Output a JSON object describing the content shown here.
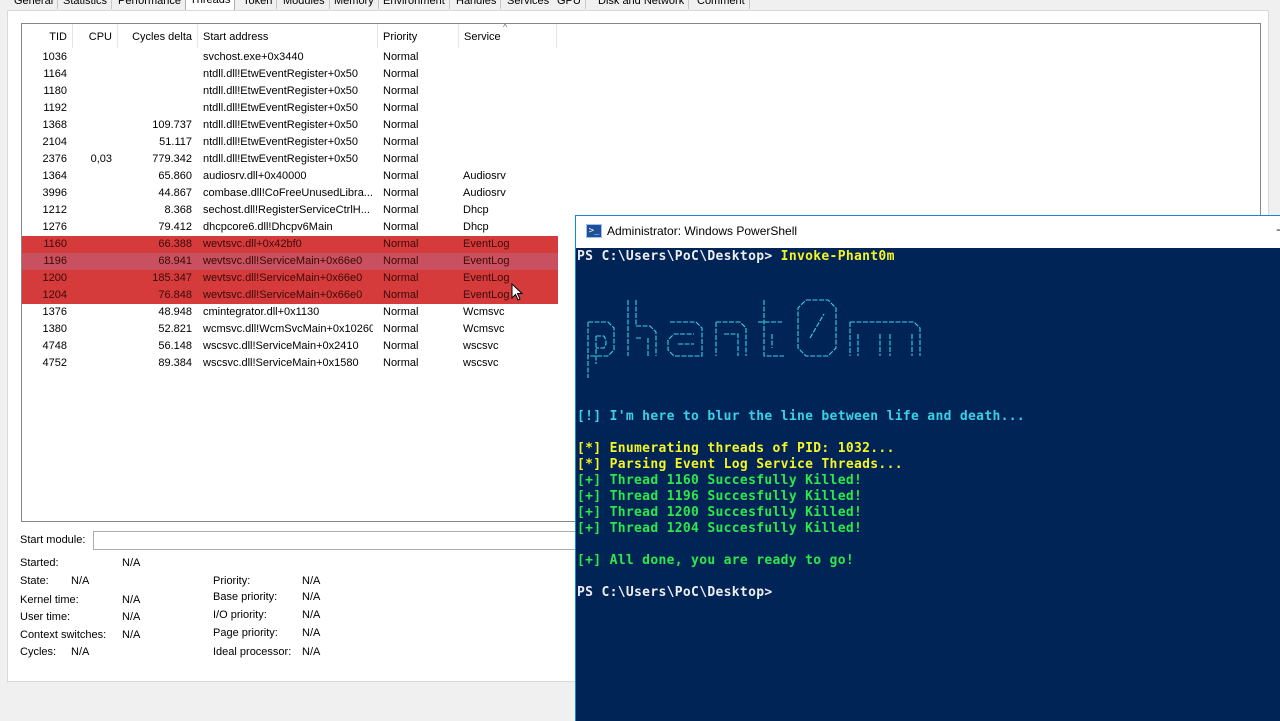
{
  "tabs": [
    "General",
    "Statistics",
    "Performance",
    "Threads",
    "Token",
    "Modules",
    "Memory",
    "Environment",
    "Handles",
    "Services",
    "GPU",
    "Disk and Network",
    "Comment"
  ],
  "active_tab": "Threads",
  "columns": {
    "tid": "TID",
    "cpu": "CPU",
    "cycles": "Cycles delta",
    "address": "Start address",
    "priority": "Priority",
    "service": "Service"
  },
  "threads": [
    {
      "tid": "1036",
      "cpu": "",
      "cycles": "",
      "address": "svchost.exe+0x3440",
      "priority": "Normal",
      "service": "",
      "highlight": false
    },
    {
      "tid": "1164",
      "cpu": "",
      "cycles": "",
      "address": "ntdll.dll!EtwEventRegister+0x50",
      "priority": "Normal",
      "service": "",
      "highlight": false
    },
    {
      "tid": "1180",
      "cpu": "",
      "cycles": "",
      "address": "ntdll.dll!EtwEventRegister+0x50",
      "priority": "Normal",
      "service": "",
      "highlight": false
    },
    {
      "tid": "1192",
      "cpu": "",
      "cycles": "",
      "address": "ntdll.dll!EtwEventRegister+0x50",
      "priority": "Normal",
      "service": "",
      "highlight": false
    },
    {
      "tid": "1368",
      "cpu": "",
      "cycles": "109.737",
      "address": "ntdll.dll!EtwEventRegister+0x50",
      "priority": "Normal",
      "service": "",
      "highlight": false
    },
    {
      "tid": "2104",
      "cpu": "",
      "cycles": "51.117",
      "address": "ntdll.dll!EtwEventRegister+0x50",
      "priority": "Normal",
      "service": "",
      "highlight": false
    },
    {
      "tid": "2376",
      "cpu": "0,03",
      "cycles": "779.342",
      "address": "ntdll.dll!EtwEventRegister+0x50",
      "priority": "Normal",
      "service": "",
      "highlight": false
    },
    {
      "tid": "1364",
      "cpu": "",
      "cycles": "65.860",
      "address": "audiosrv.dll+0x40000",
      "priority": "Normal",
      "service": "Audiosrv",
      "highlight": false
    },
    {
      "tid": "3996",
      "cpu": "",
      "cycles": "44.867",
      "address": "combase.dll!CoFreeUnusedLibra...",
      "priority": "Normal",
      "service": "Audiosrv",
      "highlight": false
    },
    {
      "tid": "1212",
      "cpu": "",
      "cycles": "8.368",
      "address": "sechost.dll!RegisterServiceCtrlH...",
      "priority": "Normal",
      "service": "Dhcp",
      "highlight": false
    },
    {
      "tid": "1276",
      "cpu": "",
      "cycles": "79.412",
      "address": "dhcpcore6.dll!Dhcpv6Main",
      "priority": "Normal",
      "service": "Dhcp",
      "highlight": false
    },
    {
      "tid": "1160",
      "cpu": "",
      "cycles": "66.388",
      "address": "wevtsvc.dll+0x42bf0",
      "priority": "Normal",
      "service": "EventLog",
      "highlight": true
    },
    {
      "tid": "1196",
      "cpu": "",
      "cycles": "68.941",
      "address": "wevtsvc.dll!ServiceMain+0x66e0",
      "priority": "Normal",
      "service": "EventLog",
      "highlight": true
    },
    {
      "tid": "1200",
      "cpu": "",
      "cycles": "185.347",
      "address": "wevtsvc.dll!ServiceMain+0x66e0",
      "priority": "Normal",
      "service": "EventLog",
      "highlight": true
    },
    {
      "tid": "1204",
      "cpu": "",
      "cycles": "76.848",
      "address": "wevtsvc.dll!ServiceMain+0x66e0",
      "priority": "Normal",
      "service": "EventLog",
      "highlight": true
    },
    {
      "tid": "1376",
      "cpu": "",
      "cycles": "48.948",
      "address": "cmintegrator.dll+0x1130",
      "priority": "Normal",
      "service": "Wcmsvc",
      "highlight": false
    },
    {
      "tid": "1380",
      "cpu": "",
      "cycles": "52.821",
      "address": "wcmsvc.dll!WcmSvcMain+0x10260",
      "priority": "Normal",
      "service": "Wcmsvc",
      "highlight": false
    },
    {
      "tid": "4748",
      "cpu": "",
      "cycles": "56.148",
      "address": "wscsvc.dll!ServiceMain+0x2410",
      "priority": "Normal",
      "service": "wscsvc",
      "highlight": false
    },
    {
      "tid": "4752",
      "cpu": "",
      "cycles": "89.384",
      "address": "wscsvc.dll!ServiceMain+0x1580",
      "priority": "Normal",
      "service": "wscsvc",
      "highlight": false
    }
  ],
  "details": {
    "start_module_label": "Start module:",
    "started_label": "Started:",
    "started_value": "N/A",
    "state_label": "State:",
    "state_value": "N/A",
    "kernel_label": "Kernel time:",
    "kernel_value": "N/A",
    "user_label": "User time:",
    "user_value": "N/A",
    "ctx_label": "Context switches:",
    "ctx_value": "N/A",
    "cycles_label": "Cycles:",
    "cycles_value": "N/A",
    "priority_label": "Priority:",
    "priority_value": "N/A",
    "base_priority_label": "Base priority:",
    "base_priority_value": "N/A",
    "io_priority_label": "I/O priority:",
    "io_priority_value": "N/A",
    "page_priority_label": "Page priority:",
    "page_priority_value": "N/A",
    "ideal_label": "Ideal processor:",
    "ideal_value": "N/A"
  },
  "powershell": {
    "title": "Administrator: Windows PowerShell",
    "close_glyph": "−",
    "prompt1": "PS C:\\Users\\PoC\\Desktop> ",
    "command": "Invoke-Phant0m",
    "banner": [
      "  _       _  _     _  _  _  _  _  __  _  _",
      " |_|  |_| _/ |_|  |_||_ |_||  |_| || | |_|",
      " |    | ||_| | |  |  | ||  |  |    |_| | | |"
    ],
    "banner_lines": [
      "                  _          _  ___ ",
      "  _  _    _   _ _| |_   /  \\ _ __ _ ",
      " | '_ \\| '_ \\ / _` | '_ \\| __|/ /\\/ '_ ` _ \\",
      " | |_) | | | | (_| | | | | |_/ /_/| | | | | |",
      " | .__/|_| |_|\\__,_|_| |_|\\__\\___/|_| |_| |_|",
      " |_|"
    ],
    "blur_line": "[!] I'm here to blur the line between life and death...",
    "enum_line": "[*] Enumerating threads of PID: 1032...",
    "parse_line": "[*] Parsing Event Log Service Threads...",
    "kill_lines": [
      "[+] Thread 1160 Succesfully Killed!",
      "[+] Thread 1196 Succesfully Killed!",
      "[+] Thread 1200 Succesfully Killed!",
      "[+] Thread 1204 Succesfully Killed!"
    ],
    "done_line": "[+] All done, you are ready to go!",
    "prompt2": "PS C:\\Users\\PoC\\Desktop>"
  },
  "colors": {
    "highlight_row": "#d63b3b",
    "console_bg": "#012456",
    "console_green": "#2ee84a",
    "console_cyan": "#3ad1e8",
    "console_yellow": "#f5f524"
  }
}
